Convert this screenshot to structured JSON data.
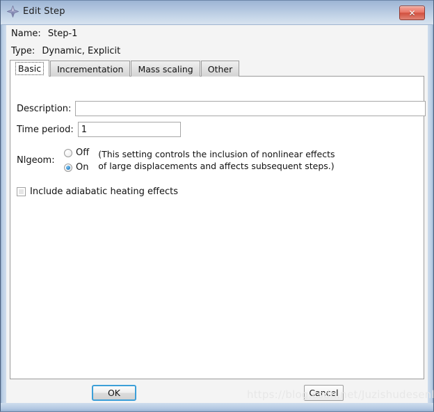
{
  "window": {
    "title": "Edit Step",
    "icon": "abaqus-diamond-icon",
    "close_label": "✕"
  },
  "header": {
    "name_label": "Name:",
    "name_value": "Step-1",
    "type_label": "Type:",
    "type_value": "Dynamic, Explicit"
  },
  "tabs": [
    {
      "label": "Basic",
      "active": true
    },
    {
      "label": "Incrementation",
      "active": false
    },
    {
      "label": "Mass scaling",
      "active": false
    },
    {
      "label": "Other",
      "active": false
    }
  ],
  "basic": {
    "description_label": "Description:",
    "description_value": "",
    "description_placeholder": "",
    "time_period_label": "Time period:",
    "time_period_value": "1",
    "nlgeom_label": "Nlgeom:",
    "nlgeom_options": [
      {
        "label": "Off",
        "selected": false
      },
      {
        "label": "On",
        "selected": true
      }
    ],
    "nlgeom_hint": "(This setting controls the inclusion of nonlinear effects\nof large displacements and affects subsequent steps.)",
    "adiabatic_label": "Include adiabatic heating effects",
    "adiabatic_checked": false
  },
  "footer": {
    "ok_label": "OK",
    "cancel_label": "Cancel"
  },
  "watermark": {
    "text": "https://blog.csdn.net/Juzishudesenlin"
  },
  "colors": {
    "titlebar_top": "#9db5d4",
    "titlebar_bottom": "#d9e4f0",
    "close_button": "#d2503f",
    "focus_blue": "#3c9fd8",
    "radio_selected": "#2a84c8",
    "panel_background": "#ffffff",
    "dialog_background": "#f4f4f4"
  }
}
